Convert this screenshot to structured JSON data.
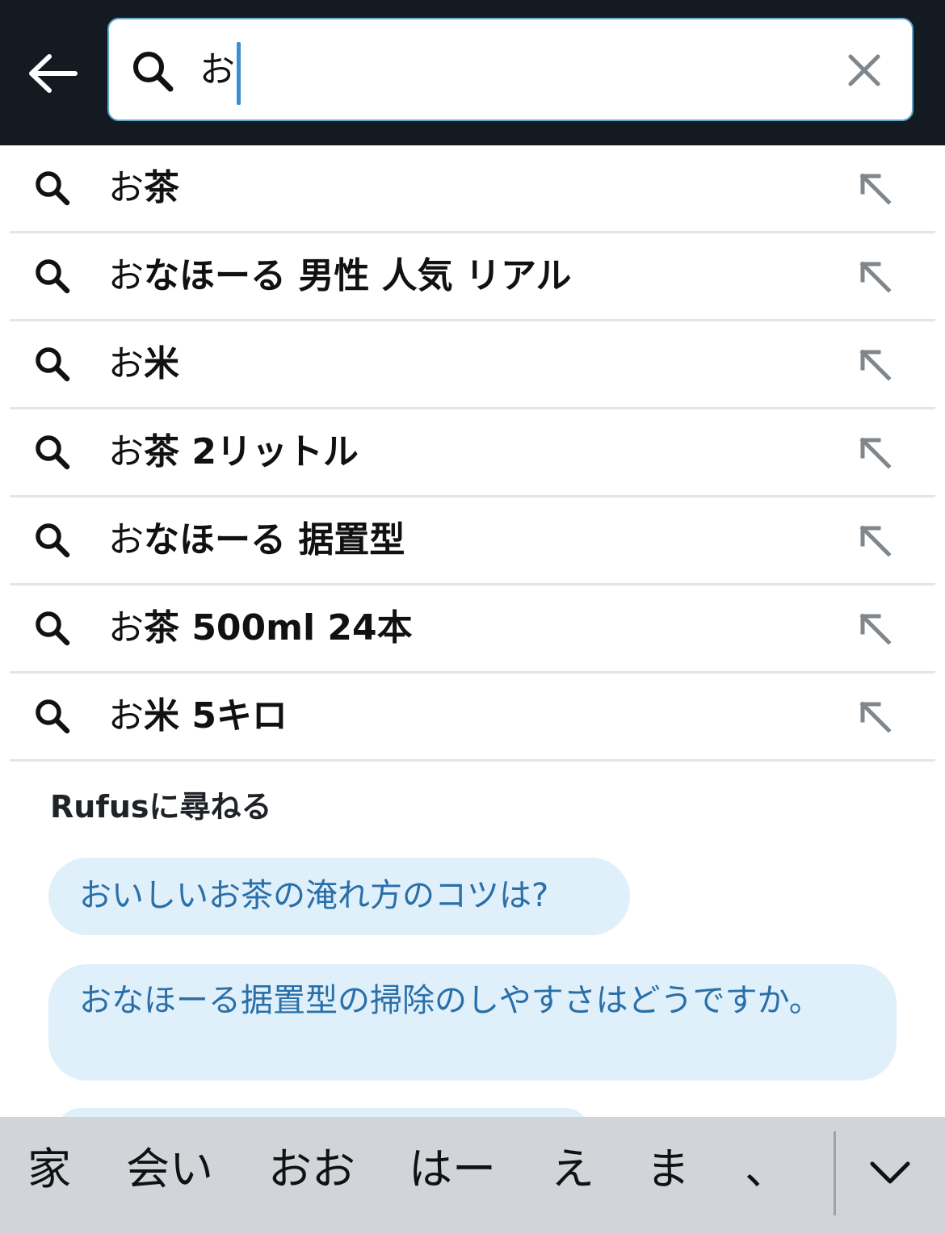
{
  "header": {
    "back_icon": "arrow-left-icon",
    "search": {
      "icon": "search-icon",
      "value": "お",
      "clear_icon": "close-icon"
    }
  },
  "suggestions": [
    {
      "prefix": "お",
      "rest": "茶"
    },
    {
      "prefix": "お",
      "rest": "なほーる 男性 人気 リアル"
    },
    {
      "prefix": "お",
      "rest": "米"
    },
    {
      "prefix": "お",
      "rest": "茶 2リットル"
    },
    {
      "prefix": "お",
      "rest": "なほーる 据置型"
    },
    {
      "prefix": "お",
      "rest": "茶 500ml 24本"
    },
    {
      "prefix": "お",
      "rest": "米 5キロ"
    }
  ],
  "rufus": {
    "title": "Rufusに尋ねる",
    "questions": [
      "おいしいお茶の淹れ方のコツは?",
      "おなほーる据置型の掃除のしやすさはどうですか。"
    ]
  },
  "keyboard": {
    "candidates": [
      "家",
      "会い",
      "おお",
      "はー",
      "え",
      "ま",
      "、"
    ],
    "collapse_icon": "chevron-down-icon"
  },
  "colors": {
    "header_bg": "#131a22",
    "chip_bg": "#dff0fb",
    "chip_text": "#2a6fa8",
    "keyboard_bg": "#d1d4d9"
  }
}
